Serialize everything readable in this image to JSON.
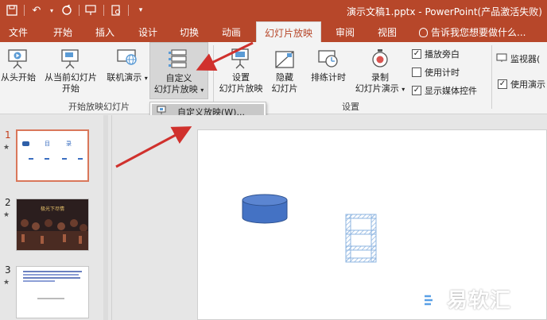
{
  "window": {
    "title": "演示文稿1.pptx - PowerPoint(产品激活失败)"
  },
  "tabs": [
    {
      "label": "文件"
    },
    {
      "label": "开始"
    },
    {
      "label": "插入"
    },
    {
      "label": "设计"
    },
    {
      "label": "切换"
    },
    {
      "label": "动画"
    },
    {
      "label": "幻灯片放映"
    },
    {
      "label": "审阅"
    },
    {
      "label": "视图"
    }
  ],
  "tell_me": "告诉我您想要做什么...",
  "ribbon": {
    "start_group": {
      "label": "开始放映幻灯片",
      "from_beginning": "从头开始",
      "from_current_1": "从当前幻灯片",
      "from_current_2": "开始",
      "online_1": "联机演示",
      "online_arrow": "▾",
      "custom_1": "自定义",
      "custom_2": "幻灯片放映",
      "custom_arrow": "▾"
    },
    "setup_group": {
      "label": "设置",
      "setup_1": "设置",
      "setup_2": "幻灯片放映",
      "hide_1": "隐藏",
      "hide_2": "幻灯片",
      "rehearse": "排练计时",
      "record_1": "录制",
      "record_2": "幻灯片演示",
      "record_arrow": "▾",
      "chk_narration": {
        "label": "播放旁白",
        "checked": true
      },
      "chk_timings": {
        "label": "使用计时",
        "checked": false
      },
      "chk_media": {
        "label": "显示媒体控件",
        "checked": true
      }
    },
    "monitor_group": {
      "monitor": "监视器(",
      "presenter": "使用演示"
    }
  },
  "dropdown": {
    "item": "自定义放映(W)..."
  },
  "slides": [
    {
      "number": "1",
      "selected": true,
      "title_a": "目",
      "title_b": "录"
    },
    {
      "number": "2",
      "selected": false,
      "heading": "极光下尽情"
    },
    {
      "number": "3",
      "selected": false
    }
  ],
  "watermark": {
    "text": "易软汇"
  },
  "colors": {
    "accent": "#b7472a",
    "arrow": "#d0312d",
    "cylinder": "#4472c4"
  }
}
